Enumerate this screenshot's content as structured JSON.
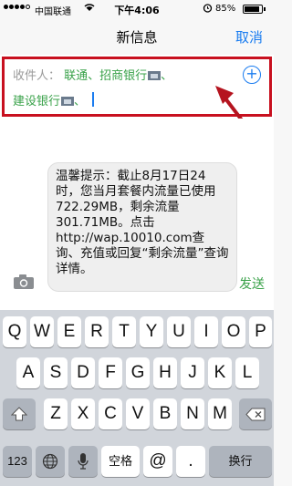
{
  "status_bar": {
    "carrier": "中国联通",
    "time": "下午4:06",
    "battery_percent": "85%",
    "battery_level": 0.85,
    "signal_bars": 4
  },
  "nav": {
    "title": "新信息",
    "cancel": "取消"
  },
  "recipients": {
    "label": "收件人：",
    "line1_names": "联通、招商银行",
    "separator": "、",
    "line2_name": "建设银行",
    "add_icon": "plus-circle-icon"
  },
  "message": {
    "text": "温馨提示：截止8月17日24时，您当月套餐内流量已使用722.29MB，剩余流量301.71MB。点击http://wap.10010.com查询、充值或回复“剩余流量”查询详情。"
  },
  "compose": {
    "send": "发送",
    "camera_icon": "camera-icon"
  },
  "keyboard": {
    "row1": [
      "Q",
      "W",
      "E",
      "R",
      "T",
      "Y",
      "U",
      "I",
      "O",
      "P"
    ],
    "row2": [
      "A",
      "S",
      "D",
      "F",
      "G",
      "H",
      "J",
      "K",
      "L"
    ],
    "row3": [
      "Z",
      "X",
      "C",
      "V",
      "B",
      "N",
      "M"
    ],
    "numbers_key": "123",
    "space_key": "空格",
    "at_key": "@",
    "dot_key": ".",
    "return_key": "换行"
  },
  "colors": {
    "accent_blue": "#1a7cf0",
    "green": "#3aa24a",
    "highlight_red": "#c8101f"
  }
}
